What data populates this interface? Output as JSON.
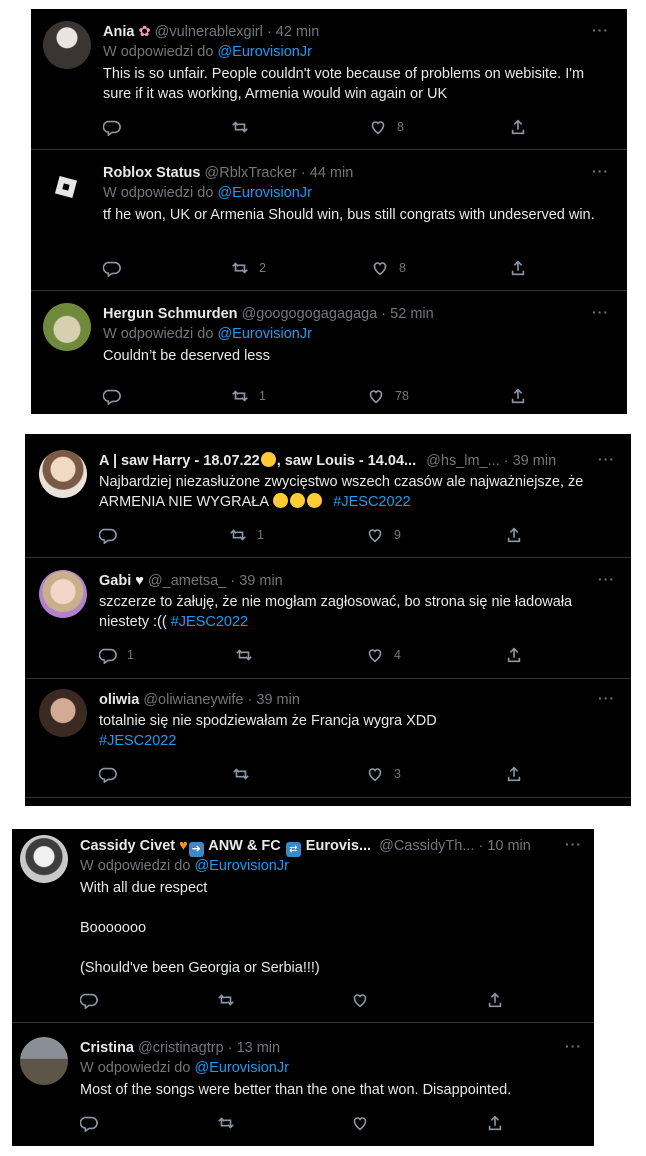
{
  "panel1": {
    "tweets": [
      {
        "name": "Ania",
        "handle": "@vulnerablexgirl",
        "time": "42 min",
        "reply_prefix": "W odpowiedzi do",
        "reply_to": "@EurovisionJr",
        "text": "This is so unfair. People couldn't vote because of problems on webisite. I'm sure if it was working, Armenia would win again or UK",
        "replies": "",
        "retweets": "",
        "likes": "8"
      },
      {
        "name": "Roblox Status",
        "handle": "@RblxTracker",
        "time": "44 min",
        "reply_prefix": "W odpowiedzi do",
        "reply_to": "@EurovisionJr",
        "text": "tf he won, UK or Armenia Should win, bus still congrats with undeserved win.",
        "replies": "",
        "retweets": "2",
        "likes": "8"
      },
      {
        "name": "Hergun Schmurden",
        "handle": "@googogogagagaga",
        "time": "52 min",
        "reply_prefix": "W odpowiedzi do",
        "reply_to": "@EurovisionJr",
        "text": "Couldn’t be deserved less",
        "replies": "",
        "retweets": "1",
        "likes": "78"
      }
    ]
  },
  "panel2": {
    "tweets": [
      {
        "name": "A | saw Harry - 18.07.22",
        "name_after": ", saw Louis - 14.04...",
        "handle": "@hs_lm_...",
        "time": "39 min",
        "text": "Najbardziej niezasłużone zwycięstwo wszech czasów ale najważniejsze, że ARMENIA NIE WYGRAŁA",
        "hashtag": "#JESC2022",
        "replies": "",
        "retweets": "1",
        "likes": "9"
      },
      {
        "name": "Gabi",
        "handle": "@_ametsa_",
        "time": "39 min",
        "text": "szczerze to żałuję, że nie mogłam zagłosować, bo strona się nie ładowała niestety :((",
        "hashtag": "#JESC2022",
        "replies": "1",
        "retweets": "",
        "likes": "4"
      },
      {
        "name": "oliwia",
        "handle": "@oliwianeywife",
        "time": "39 min",
        "text": "totalnie się nie spodziewałam że Francja wygra XDD",
        "hashtag": "#JESC2022",
        "replies": "",
        "retweets": "",
        "likes": "3"
      }
    ]
  },
  "panel3": {
    "tweets": [
      {
        "name": "Cassidy Civet",
        "name_mid": " ANW & FC ",
        "name_end": " Eurovis...",
        "handle": "@CassidyTh...",
        "time": "10 min",
        "reply_prefix": "W odpowiedzi do",
        "reply_to": "@EurovisionJr",
        "lines": [
          "With all due respect",
          "Booooooo",
          "(Should've been Georgia or Serbia!!!)"
        ],
        "replies": "",
        "retweets": "",
        "likes": ""
      },
      {
        "name": "Cristina",
        "handle": "@cristinagtrp",
        "time": "13 min",
        "reply_prefix": "W odpowiedzi do",
        "reply_to": "@EurovisionJr",
        "text": "Most of the songs were better than the one that won. Disappointed.",
        "replies": "",
        "retweets": "",
        "likes": ""
      }
    ]
  },
  "ui": {
    "sep": " · ",
    "more": "···"
  },
  "colors": {
    "bg": "#000000",
    "text": "#e7e9ea",
    "muted": "#71767b",
    "accent": "#1d9bf0",
    "divider": "#2f3336"
  },
  "icons": [
    "reply-icon",
    "retweet-icon",
    "like-icon",
    "share-icon",
    "more-icon",
    "heart-emoji",
    "arrow-emoji",
    "shuffle-emoji",
    "star-struck-emoji",
    "partying-face-emoji",
    "white-heart-emoji",
    "orange-heart-emoji"
  ]
}
